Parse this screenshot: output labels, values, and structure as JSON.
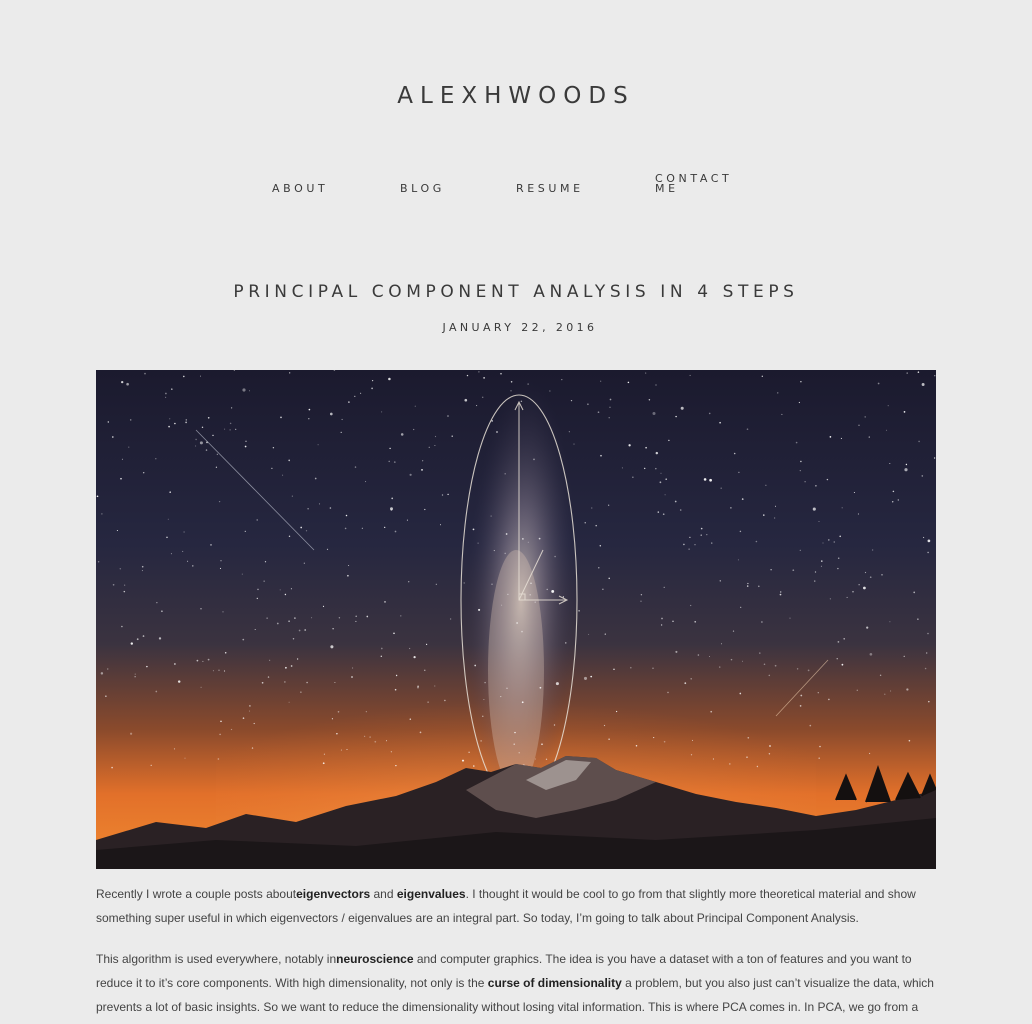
{
  "site": {
    "title": "ALEXHWOODS"
  },
  "nav": {
    "about": "ABOUT",
    "blog": "BLOG",
    "resume": "RESUME",
    "contact": "CONTACT ME"
  },
  "post": {
    "title": "PRINCIPAL COMPONENT ANALYSIS IN 4 STEPS",
    "date": "JANUARY 22, 2016",
    "hero_image": "milky-way-over-mountain-with-pca-ellipse",
    "paragraphs": [
      {
        "t1": "Recently I wrote a couple posts about",
        "b1": "eigenvectors",
        "t2": " and ",
        "b2": "eigenvalues",
        "t3": ". I thought it would be cool to go from that slightly more theoretical material and show something super useful in which eigenvectors / eigenvalues are an integral part. So today, I’m going to talk about Principal Component Analysis."
      },
      {
        "t1": "This algorithm is used everywhere, notably in",
        "b1": "neuroscience",
        "t2": " and computer graphics. The idea is you have a dataset with a ton of features and you want to reduce it to it’s core components. With high dimensionality, not only is the ",
        "b2": "curse of dimensionality",
        "t3": " a problem, but you also just can’t visualize the data, which prevents a lot of basic insights. So we want to reduce the dimensionality without losing vital information. This is where PCA comes in. In PCA, we go from a"
      }
    ]
  },
  "colors": {
    "background": "#ebebeb",
    "text": "#3a3a3a",
    "sky_top": "#1b1a2e",
    "horizon_glow": "#e2702a"
  }
}
